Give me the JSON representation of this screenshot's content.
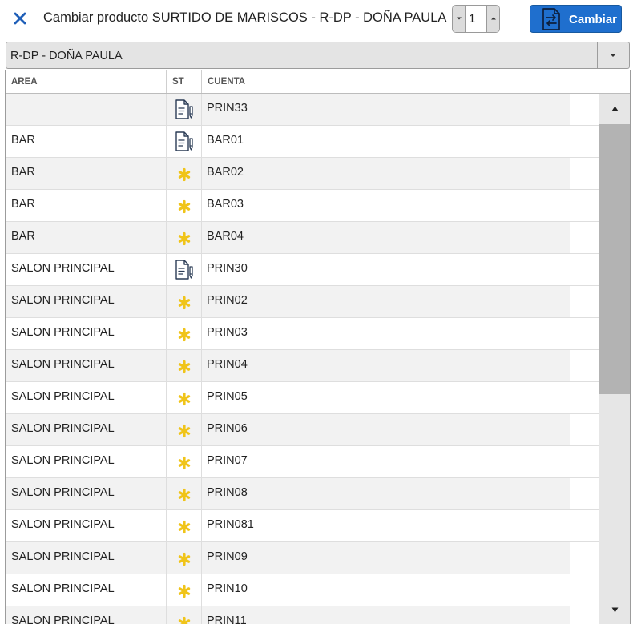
{
  "dialog": {
    "title": "Cambiar producto SURTIDO DE MARISCOS - R-DP - DOÑA PAULA",
    "quantity": "1",
    "change_label": "Cambiar"
  },
  "icons": {
    "close": "close-icon",
    "decrement": "chevron-down-icon",
    "increment": "chevron-up-icon",
    "change": "document-swap-icon",
    "order_status": "document-pen-icon",
    "free_status": "asterisk-icon",
    "scroll_up": "triangle-up-icon",
    "scroll_down": "triangle-down-icon"
  },
  "colors": {
    "accent": "#1f6fce",
    "close_icon": "#1f5fb8",
    "asterisk": "#f0c419",
    "row_alt": "#f2f2f2"
  },
  "filter": {
    "selected": "R-DP - DOÑA PAULA"
  },
  "table": {
    "columns": [
      "AREA",
      "ST",
      "CUENTA"
    ],
    "rows": [
      {
        "area": "",
        "st": "order",
        "cuenta": "PRIN33"
      },
      {
        "area": "BAR",
        "st": "order",
        "cuenta": "BAR01"
      },
      {
        "area": "BAR",
        "st": "free",
        "cuenta": "BAR02"
      },
      {
        "area": "BAR",
        "st": "free",
        "cuenta": "BAR03"
      },
      {
        "area": "BAR",
        "st": "free",
        "cuenta": "BAR04"
      },
      {
        "area": "SALON PRINCIPAL",
        "st": "order",
        "cuenta": "PRIN30"
      },
      {
        "area": "SALON PRINCIPAL",
        "st": "free",
        "cuenta": "PRIN02"
      },
      {
        "area": "SALON PRINCIPAL",
        "st": "free",
        "cuenta": "PRIN03"
      },
      {
        "area": "SALON PRINCIPAL",
        "st": "free",
        "cuenta": "PRIN04"
      },
      {
        "area": "SALON PRINCIPAL",
        "st": "free",
        "cuenta": "PRIN05"
      },
      {
        "area": "SALON PRINCIPAL",
        "st": "free",
        "cuenta": "PRIN06"
      },
      {
        "area": "SALON PRINCIPAL",
        "st": "free",
        "cuenta": "PRIN07"
      },
      {
        "area": "SALON PRINCIPAL",
        "st": "free",
        "cuenta": "PRIN08"
      },
      {
        "area": "SALON PRINCIPAL",
        "st": "free",
        "cuenta": "PRIN081"
      },
      {
        "area": "SALON PRINCIPAL",
        "st": "free",
        "cuenta": "PRIN09"
      },
      {
        "area": "SALON PRINCIPAL",
        "st": "free",
        "cuenta": "PRIN10"
      },
      {
        "area": "SALON PRINCIPAL",
        "st": "free",
        "cuenta": "PRIN11"
      }
    ]
  },
  "scroll": {
    "visible_fraction": 0.57,
    "position": 0.0
  }
}
